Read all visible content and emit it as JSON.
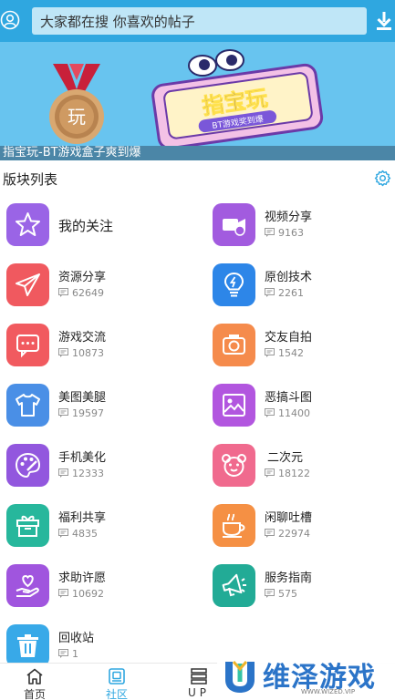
{
  "search": {
    "text": "大家都在搜  你喜欢的帖子"
  },
  "banner": {
    "caption": "指宝玩-BT游戏盒子爽到爆",
    "logo_text": "指宝玩",
    "logo_subtext": "BT游戏奖到爆",
    "medal_text": "玩"
  },
  "section": {
    "title": "版块列表"
  },
  "boards": [
    {
      "name": "我的关注",
      "count": "",
      "icon": "star-icon",
      "color": "#9a64e6"
    },
    {
      "name": "视频分享",
      "count": "9163",
      "icon": "video-camera-icon",
      "color": "#a25bdf"
    },
    {
      "name": "资源分享",
      "count": "62649",
      "icon": "paper-plane-icon",
      "color": "#f0595f"
    },
    {
      "name": "原创技术",
      "count": "2261",
      "icon": "lightbulb-icon",
      "color": "#2d86e8"
    },
    {
      "name": "游戏交流",
      "count": "10873",
      "icon": "chat-bubble-icon",
      "color": "#f15a5f"
    },
    {
      "name": "交友自拍",
      "count": "1542",
      "icon": "camera-icon",
      "color": "#f58b4c"
    },
    {
      "name": "美图美腿",
      "count": "19597",
      "icon": "tshirt-icon",
      "color": "#4a8fe6"
    },
    {
      "name": "恶搞斗图",
      "count": "11400",
      "icon": "image-icon",
      "color": "#b256df"
    },
    {
      "name": "手机美化",
      "count": "12333",
      "icon": "palette-icon",
      "color": "#9257de"
    },
    {
      "name": "二次元",
      "count": "18122",
      "icon": "bear-icon",
      "color": "#f06a8e"
    },
    {
      "name": "福利共享",
      "count": "4835",
      "icon": "gift-icon",
      "color": "#27b79c"
    },
    {
      "name": "闲聊吐槽",
      "count": "22974",
      "icon": "coffee-cup-icon",
      "color": "#f59044"
    },
    {
      "name": "求助许愿",
      "count": "10692",
      "icon": "heart-hand-icon",
      "color": "#a055de"
    },
    {
      "name": "服务指南",
      "count": "575",
      "icon": "megaphone-icon",
      "color": "#22ab96"
    },
    {
      "name": "回收站",
      "count": "1",
      "icon": "trash-icon",
      "color": "#38a9e8"
    }
  ],
  "nav": [
    {
      "label": "首页",
      "icon": "home-icon",
      "active": false
    },
    {
      "label": "社区",
      "icon": "community-icon",
      "active": true
    },
    {
      "label": "UP",
      "icon": "up-icon",
      "active": false
    }
  ],
  "watermark": {
    "text": "维泽游戏",
    "url": "WWW.WIZED.VIP"
  },
  "colors": {
    "accent": "#2fa7e0",
    "banner_bg": "#68c4ef"
  }
}
